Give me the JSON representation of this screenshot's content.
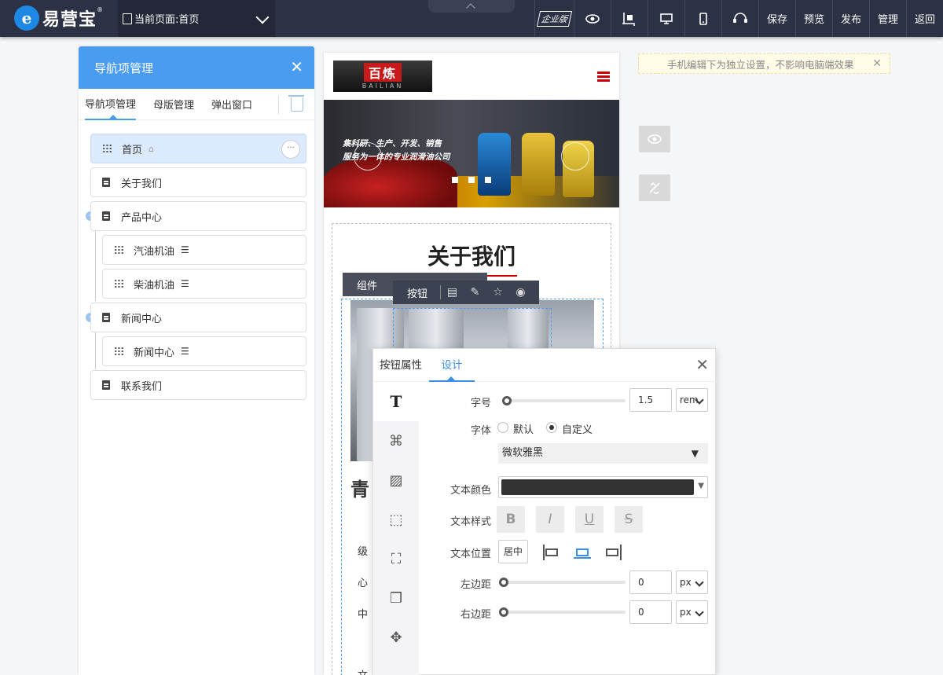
{
  "topbar": {
    "logo_letter": "e",
    "logo_text": "易营宝",
    "logo_mark": "®",
    "page_selector": "当前页面:首页",
    "enterprise_badge": "企业版",
    "buttons": [
      "保存",
      "预览",
      "发布",
      "管理",
      "返回"
    ],
    "icons": [
      "eye-icon",
      "select-area-icon",
      "desktop-icon",
      "mobile-icon",
      "support-icon"
    ]
  },
  "nav_panel": {
    "title": "导航项管理",
    "close": "✕",
    "tabs": [
      "导航项管理",
      "母版管理",
      "弹出窗口"
    ],
    "active_tab": 0,
    "items": [
      {
        "label": "首页",
        "level": 0,
        "type": "grip",
        "suffix": "home",
        "selected": true
      },
      {
        "label": "关于我们",
        "level": 0,
        "type": "page"
      },
      {
        "label": "产品中心",
        "level": 0,
        "type": "page",
        "collapsible": true
      },
      {
        "label": "汽油机油",
        "level": 1,
        "type": "grip",
        "suffix": "list"
      },
      {
        "label": "柴油机油",
        "level": 1,
        "type": "grip",
        "suffix": "list"
      },
      {
        "label": "新闻中心",
        "level": 0,
        "type": "page",
        "collapsible": true
      },
      {
        "label": "新闻中心",
        "level": 1,
        "type": "grip",
        "suffix": "list"
      },
      {
        "label": "联系我们",
        "level": 0,
        "type": "page"
      }
    ],
    "more_label": "···",
    "home_glyph": "⌂",
    "list_glyph": "☰",
    "collapse_glyph": "-"
  },
  "preview": {
    "logo_cn": "百炼",
    "logo_en": "BAILIAN",
    "banner_line1": "集科研、生产、开发、销售",
    "banner_line2": "服务为一体的专业润滑油公司",
    "about_title": "关于我们",
    "component_label": "组件",
    "button_label": "按钮",
    "text_fragments": [
      "青",
      "级",
      "心",
      "中",
      "文"
    ]
  },
  "hint": {
    "text": "手机编辑下为独立设置，不影响电脑端效果",
    "close": "✕"
  },
  "design_panel": {
    "tabs": [
      "按钮属性",
      "设计"
    ],
    "active_tab": 1,
    "close": "✕",
    "side_icons": [
      "text-icon",
      "effects-icon",
      "background-icon",
      "border-icon",
      "corner-icon",
      "shadow-icon",
      "position-icon"
    ],
    "font_size": {
      "label": "字号",
      "value": "1.5",
      "unit": "rem",
      "level": 0.0
    },
    "font_family": {
      "label": "字体",
      "option_default": "默认",
      "option_custom": "自定义",
      "selected": "自定义",
      "font": "微软雅黑"
    },
    "text_color": {
      "label": "文本颜色",
      "color": "#333333"
    },
    "text_style": {
      "label": "文本样式",
      "bold": "B",
      "italic": "I",
      "underline": "U",
      "strike": "S"
    },
    "text_position": {
      "label": "文本位置",
      "value": "居中"
    },
    "margin_left": {
      "label": "左边距",
      "value": "0",
      "unit": "px",
      "level": 0.0
    },
    "margin_right": {
      "label": "右边距",
      "value": "0",
      "unit": "px",
      "level": 0.0
    }
  },
  "colors": {
    "topbar": "#2c3145",
    "accent": "#4a9cf0",
    "active_tab": "#3a8ee6"
  }
}
